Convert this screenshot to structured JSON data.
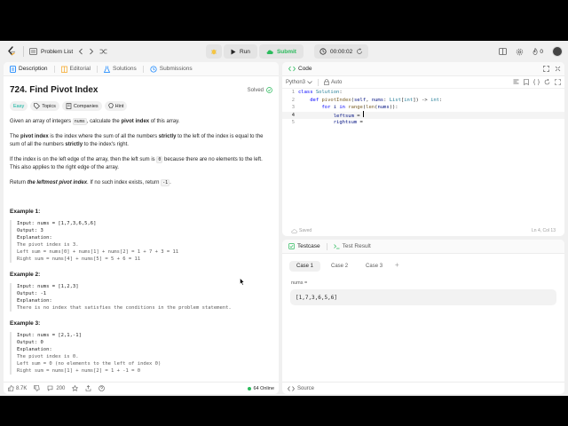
{
  "topbar": {
    "problem_list_label": "Problem List",
    "run_label": "Run",
    "submit_label": "Submit",
    "timer": "00:00:02",
    "points": "0",
    "accent": "#2cbb5d"
  },
  "left_tabs": {
    "description": "Description",
    "editorial": "Editorial",
    "solutions": "Solutions",
    "submissions": "Submissions"
  },
  "problem": {
    "title": "724. Find Pivot Index",
    "status": "Solved",
    "difficulty": "Easy",
    "topics": "Topics",
    "companies": "Companies",
    "hint": "Hint",
    "p1_a": "Given an array of integers ",
    "p1_code": "nums",
    "p1_b": ", calculate the ",
    "p1_bold": "pivot index",
    "p1_c": " of this array.",
    "p2_a": "The ",
    "p2_bold1": "pivot index",
    "p2_b": " is the index where the sum of all the numbers ",
    "p2_bold2": "strictly",
    "p2_c": " to the left of the index is equal to the sum of all the numbers ",
    "p2_bold3": "strictly",
    "p2_d": " to the index's right.",
    "p3_a": "If the index is on the left edge of the array, then the left sum is ",
    "p3_code": "0",
    "p3_b": " because there are no elements to the left. This also applies to the right edge of the array.",
    "p4_a": "Return ",
    "p4_bold": "the leftmost pivot index",
    "p4_b": ". If no such index exists, return ",
    "p4_code": "-1",
    "p4_c": "."
  },
  "examples": [
    {
      "title": "Example 1:",
      "input": "Input: nums = [1,7,3,6,5,6]",
      "output": "Output: 3",
      "explanation_label": "Explanation:",
      "lines": [
        "The pivot index is 3.",
        "Left sum = nums[0] + nums[1] + nums[2] = 1 + 7 + 3 = 11",
        "Right sum = nums[4] + nums[5] = 5 + 6 = 11"
      ]
    },
    {
      "title": "Example 2:",
      "input": "Input: nums = [1,2,3]",
      "output": "Output: -1",
      "explanation_label": "Explanation:",
      "lines": [
        "There is no index that satisfies the conditions in the problem statement."
      ]
    },
    {
      "title": "Example 3:",
      "input": "Input: nums = [2,1,-1]",
      "output": "Output: 0",
      "explanation_label": "Explanation:",
      "lines": [
        "The pivot index is 0.",
        "Left sum = 0 (no elements to the left of index 0)",
        "Right sum = nums[1] + nums[2] = 1 + -1 = 0"
      ]
    }
  ],
  "footer": {
    "likes": "8.7K",
    "comments": "200",
    "online": "64 Online"
  },
  "code": {
    "tab_label": "Code",
    "language": "Python3",
    "auto": "Auto",
    "saved": "Saved",
    "position": "Ln 4, Col 13",
    "line_numbers": [
      "1",
      "2",
      "3",
      "4",
      "5"
    ]
  },
  "testcase": {
    "tab_label": "Testcase",
    "result_label": "Test Result",
    "cases": [
      "Case 1",
      "Case 2",
      "Case 3"
    ],
    "var_label": "nums =",
    "var_value": "[1,7,3,6,5,6]",
    "source": "Source"
  }
}
